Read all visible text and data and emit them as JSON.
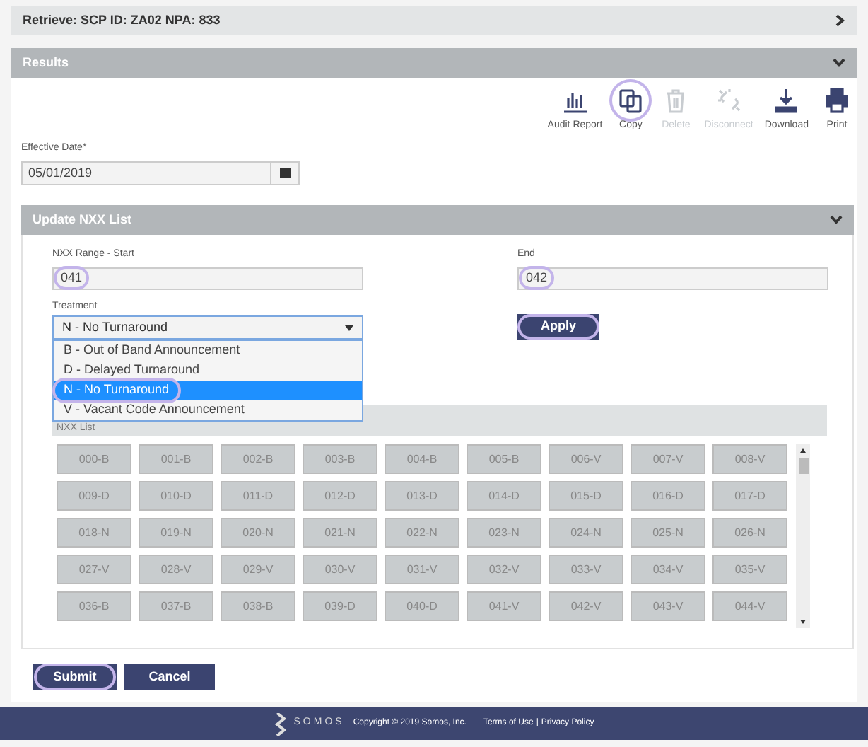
{
  "retrieve_bar": {
    "title": "Retrieve: SCP ID: ZA02 NPA: 833"
  },
  "results": {
    "title": "Results",
    "toolbar": [
      {
        "kind": "report",
        "label": "Audit Report",
        "disabled": false,
        "highlighted": false
      },
      {
        "kind": "copy",
        "label": "Copy",
        "disabled": false,
        "highlighted": true
      },
      {
        "kind": "delete",
        "label": "Delete",
        "disabled": true,
        "highlighted": false
      },
      {
        "kind": "disconnect",
        "label": "Disconnect",
        "disabled": true,
        "highlighted": false
      },
      {
        "kind": "download",
        "label": "Download",
        "disabled": false,
        "highlighted": false
      },
      {
        "kind": "print",
        "label": "Print",
        "disabled": false,
        "highlighted": false
      }
    ],
    "effective_date": {
      "label": "Effective Date*",
      "value": "05/01/2019"
    }
  },
  "update_panel": {
    "title": "Update NXX List",
    "range_start": {
      "label": "NXX Range - Start",
      "value": "041",
      "highlighted": true
    },
    "range_end": {
      "label": "End",
      "value": "042",
      "highlighted": true
    },
    "treatment": {
      "label": "Treatment",
      "value": "N - No Turnaround",
      "expanded": true,
      "options": [
        {
          "label": "B - Out of Band Announcement",
          "selected": false,
          "highlighted": false
        },
        {
          "label": "D - Delayed Turnaround",
          "selected": false,
          "highlighted": false
        },
        {
          "label": "N - No Turnaround",
          "selected": true,
          "highlighted": true
        },
        {
          "label": "V - Vacant Code Announcement",
          "selected": false,
          "highlighted": false
        }
      ]
    },
    "apply_button": {
      "label": "Apply",
      "highlighted": true
    },
    "nxx_list": {
      "label": "NXX List",
      "cells": [
        "000-B",
        "001-B",
        "002-B",
        "003-B",
        "004-B",
        "005-B",
        "006-V",
        "007-V",
        "008-V",
        "009-D",
        "010-D",
        "011-D",
        "012-D",
        "013-D",
        "014-D",
        "015-D",
        "016-D",
        "017-D",
        "018-N",
        "019-N",
        "020-N",
        "021-N",
        "022-N",
        "023-N",
        "024-N",
        "025-N",
        "026-N",
        "027-V",
        "028-V",
        "029-V",
        "030-V",
        "031-V",
        "032-V",
        "033-V",
        "034-V",
        "035-V",
        "036-B",
        "037-B",
        "038-B",
        "039-D",
        "040-D",
        "041-V",
        "042-V",
        "043-V",
        "044-V"
      ]
    }
  },
  "buttons": [
    {
      "label": "Submit",
      "highlighted": true
    },
    {
      "label": "Cancel",
      "highlighted": false
    }
  ],
  "footer": {
    "logo": "SOMOS",
    "copyright": "Copyright © 2019 Somos, Inc.",
    "links": [
      "Terms of Use",
      "Privacy Policy"
    ],
    "separator": "|"
  }
}
